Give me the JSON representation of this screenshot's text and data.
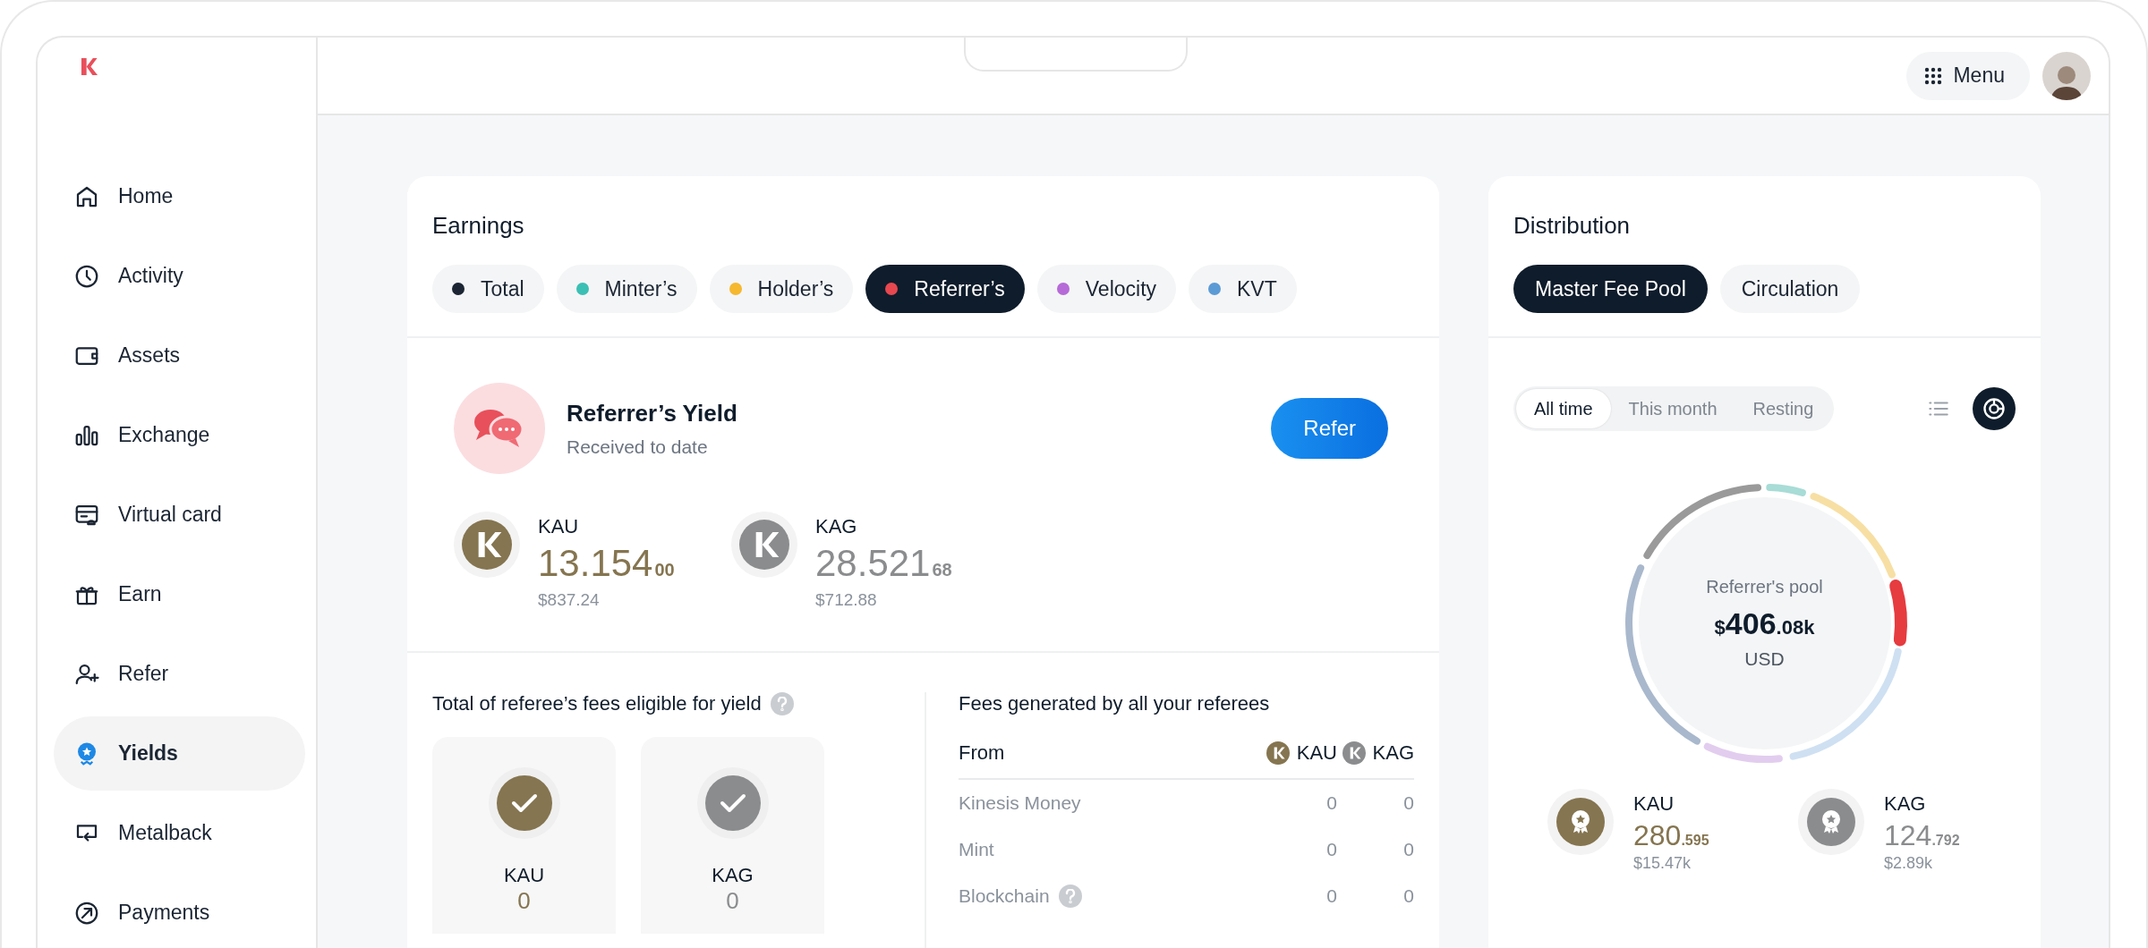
{
  "sidebar": {
    "items": [
      {
        "label": "Home",
        "selected": false
      },
      {
        "label": "Activity",
        "selected": false
      },
      {
        "label": "Assets",
        "selected": false
      },
      {
        "label": "Exchange",
        "selected": false
      },
      {
        "label": "Virtual card",
        "selected": false
      },
      {
        "label": "Earn",
        "selected": false
      },
      {
        "label": "Refer",
        "selected": false
      },
      {
        "label": "Yields",
        "selected": true
      },
      {
        "label": "Metalback",
        "selected": false
      },
      {
        "label": "Payments",
        "selected": false
      }
    ]
  },
  "topbar": {
    "menu_button": "Menu"
  },
  "earnings": {
    "title": "Earnings",
    "tabs": [
      {
        "label": "Total",
        "color": "#1b2533",
        "selected": false
      },
      {
        "label": "Minter’s",
        "color": "#3bbfb4",
        "selected": false
      },
      {
        "label": "Holder’s",
        "color": "#f5b82e",
        "selected": false
      },
      {
        "label": "Referrer’s",
        "color": "#e8474f",
        "selected": true
      },
      {
        "label": "Velocity",
        "color": "#b56ad8",
        "selected": false
      },
      {
        "label": "KVT",
        "color": "#5b9bd5",
        "selected": false
      }
    ],
    "yield": {
      "title": "Referrer’s Yield",
      "subtitle": "Received to date",
      "button": "Refer",
      "coins": [
        {
          "symbol": "KAU",
          "amount": "13.154",
          "decimals": "00",
          "usd": "$837.24",
          "color": "#857550"
        },
        {
          "symbol": "KAG",
          "amount": "28.521",
          "decimals": "68",
          "usd": "$712.88",
          "color": "#8b8c8e"
        }
      ]
    },
    "eligible": {
      "title": "Total of referee’s fees eligible for yield",
      "cards": [
        {
          "symbol": "KAU",
          "value": "0",
          "color": "#857550"
        },
        {
          "symbol": "KAG",
          "value": "0",
          "color": "#8b8c8e"
        }
      ]
    },
    "fees": {
      "title": "Fees generated by all your referees",
      "columns": [
        {
          "label": "From"
        },
        {
          "label": "KAU",
          "color": "#857550"
        },
        {
          "label": "KAG",
          "color": "#8b8c8e"
        }
      ],
      "rows": [
        {
          "cells": [
            "Kinesis Money",
            "0",
            "0"
          ],
          "help": false
        },
        {
          "cells": [
            "Mint",
            "0",
            "0"
          ],
          "help": false
        },
        {
          "cells": [
            "Blockchain",
            "0",
            "0"
          ],
          "help": true
        }
      ]
    }
  },
  "distribution": {
    "title": "Distribution",
    "tabs": [
      {
        "label": "Master Fee Pool",
        "selected": true
      },
      {
        "label": "Circulation",
        "selected": false
      }
    ],
    "periods": [
      {
        "label": "All time",
        "selected": true
      },
      {
        "label": "This month",
        "selected": false
      },
      {
        "label": "Resting",
        "selected": false
      }
    ],
    "views": [
      {
        "kind": "list",
        "selected": false
      },
      {
        "kind": "donut",
        "selected": true
      }
    ],
    "pool": {
      "label": "Referrer's pool",
      "currency": "$",
      "whole": "406",
      "fraction": ".08k",
      "unit": "USD"
    },
    "coins": [
      {
        "symbol": "KAU",
        "whole": "280",
        "fraction": ".595",
        "usd": "$15.47k",
        "color": "#857550"
      },
      {
        "symbol": "KAG",
        "whole": "124",
        "fraction": ".792",
        "usd": "$2.89k",
        "color": "#8b8c8e"
      }
    ]
  }
}
